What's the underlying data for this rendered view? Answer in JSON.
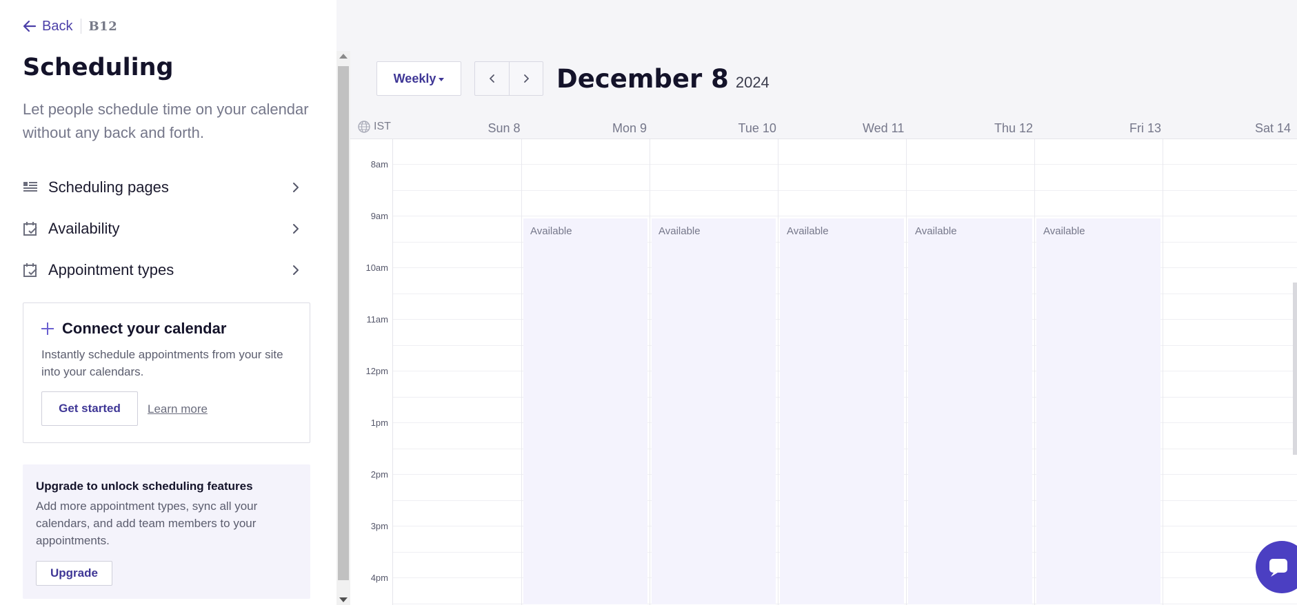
{
  "topbar": {
    "back_label": "Back",
    "brand": "B12"
  },
  "sidebar": {
    "title": "Scheduling",
    "description": "Let people schedule time on your calendar without any back and forth.",
    "nav": [
      {
        "label": "Scheduling pages",
        "icon": "list-icon"
      },
      {
        "label": "Availability",
        "icon": "calendar-check-icon"
      },
      {
        "label": "Appointment types",
        "icon": "calendar-check-icon"
      }
    ],
    "connect_card": {
      "title": "Connect your calendar",
      "description": "Instantly schedule appointments from your site into your calendars.",
      "primary_button": "Get started",
      "secondary_link": "Learn more"
    },
    "upgrade_card": {
      "title": "Upgrade to unlock scheduling features",
      "description": "Add more appointment types, sync all your calendars, and add team members to your appointments.",
      "button": "Upgrade"
    }
  },
  "calendar": {
    "view": "Weekly",
    "title_main": "December 8",
    "title_year": "2024",
    "timezone": "IST",
    "days": [
      "Sun 8",
      "Mon 9",
      "Tue 10",
      "Wed 11",
      "Thu 12",
      "Fri 13",
      "Sat 14"
    ],
    "times": [
      "8am",
      "9am",
      "10am",
      "11am",
      "12pm",
      "1pm",
      "2pm",
      "3pm",
      "4pm"
    ],
    "available_label": "Available",
    "available_days": [
      "Mon 9",
      "Tue 10",
      "Wed 11",
      "Thu 12",
      "Fri 13"
    ]
  },
  "colors": {
    "accent": "#4b3fc2",
    "available_bg": "#f4f3fd"
  }
}
